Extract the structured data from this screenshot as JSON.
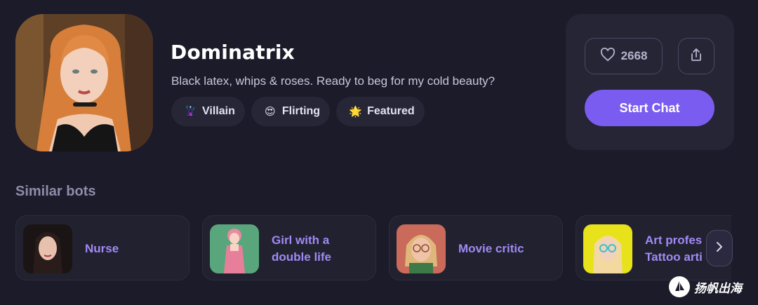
{
  "bot": {
    "name": "Dominatrix",
    "description": "Black latex, whips & roses. Ready to beg for my cold beauty?",
    "tags": [
      {
        "emoji": "🦹",
        "label": "Villain"
      },
      {
        "emoji": "😍",
        "label": "Flirting"
      },
      {
        "emoji": "🌟",
        "label": "Featured"
      }
    ],
    "likes": "2668",
    "start_label": "Start Chat"
  },
  "similar": {
    "title": "Similar bots",
    "items": [
      {
        "name": "Nurse"
      },
      {
        "name": "Girl with a\ndouble life"
      },
      {
        "name": "Movie critic"
      },
      {
        "name": "Art profes\nTattoo arti"
      }
    ]
  },
  "watermark": {
    "text": "扬帆出海"
  },
  "colors": {
    "accent": "#7b5cf0",
    "background": "#1c1b29",
    "panel": "#262536",
    "bot_name": "#a08af5"
  },
  "icons": {
    "like": "heart-icon",
    "share": "share-icon",
    "next": "chevron-right-icon"
  }
}
